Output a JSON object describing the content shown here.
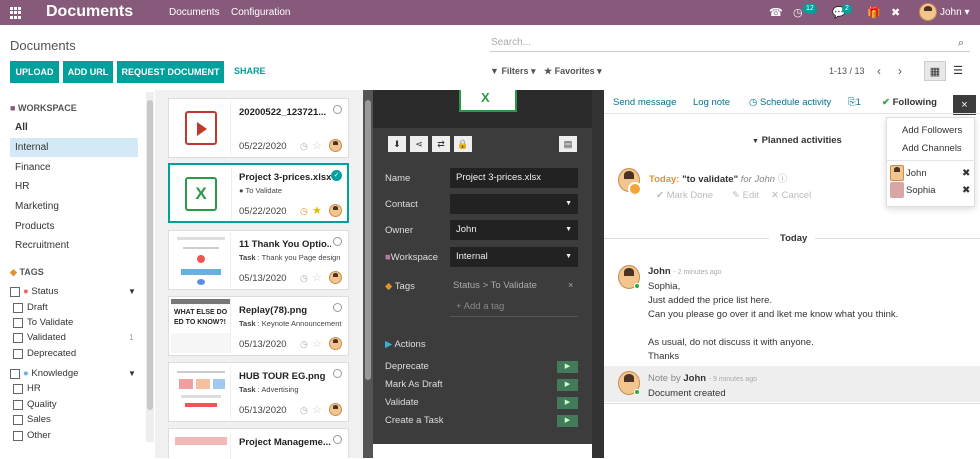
{
  "app": {
    "title": "Documents"
  },
  "topmenu": [
    "Documents",
    "Configuration"
  ],
  "systray": {
    "activity_count": "12",
    "message_count": "2",
    "user": "John"
  },
  "cp": {
    "title": "Documents",
    "search_placeholder": "Search...",
    "buttons": [
      "UPLOAD",
      "ADD URL",
      "REQUEST DOCUMENT"
    ],
    "share": "SHARE",
    "filters": "Filters",
    "favorites": "Favorites",
    "pager": "1-13 / 13"
  },
  "sidebar": {
    "workspace_title": "WORKSPACE",
    "workspaces": [
      "All",
      "Internal",
      "Finance",
      "HR",
      "Marketing",
      "Products",
      "Recruitment"
    ],
    "tags_title": "TAGS",
    "tag_groups": [
      {
        "name": "Status",
        "tags": [
          {
            "label": "Draft",
            "count": ""
          },
          {
            "label": "To Validate",
            "count": ""
          },
          {
            "label": "Validated",
            "count": "1"
          },
          {
            "label": "Deprecated",
            "count": ""
          }
        ]
      },
      {
        "name": "Knowledge",
        "tags": [
          {
            "label": "HR",
            "count": ""
          },
          {
            "label": "Quality",
            "count": ""
          },
          {
            "label": "Sales",
            "count": ""
          },
          {
            "label": "Other",
            "count": ""
          }
        ]
      }
    ]
  },
  "cards": [
    {
      "title": "20200522_123721...",
      "sub": "",
      "date": "05/22/2020"
    },
    {
      "title": "Project 3-prices.xlsx",
      "sub": "● To Validate",
      "date": "05/22/2020"
    },
    {
      "title": "11 Thank You Optio...",
      "sub_label": "Task",
      "sub": ": Thank you Page design",
      "date": "05/13/2020"
    },
    {
      "title": "Replay(78).png",
      "sub_label": "Task",
      "sub": ": Keynote Announcement",
      "date": "05/13/2020"
    },
    {
      "title": "HUB TOUR EG.png",
      "sub_label": "Task",
      "sub": ": Advertising",
      "date": "05/13/2020"
    },
    {
      "title": "Project Manageme...",
      "sub": "",
      "date": ""
    }
  ],
  "preview": {
    "fields": [
      {
        "label": "Name",
        "value": "Project 3-prices.xlsx",
        "dropdown": false
      },
      {
        "label": "Contact",
        "value": "",
        "dropdown": true
      },
      {
        "label": "Owner",
        "value": "John",
        "dropdown": true
      },
      {
        "label": "Workspace",
        "value": "Internal",
        "dropdown": true
      }
    ],
    "tags_label": "Tags",
    "tag_value": "Status > To Validate",
    "add_tag": "+ Add a tag",
    "actions_title": "Actions",
    "actions": [
      "Deprecate",
      "Mark As Draft",
      "Validate",
      "Create a Task"
    ]
  },
  "chatter": {
    "send_message": "Send message",
    "log_note": "Log note",
    "schedule": "Schedule activity",
    "attachments": "1",
    "following": "Following",
    "followers_menu": {
      "add_followers": "Add Followers",
      "add_channels": "Add Channels",
      "followers": [
        "John",
        "Sophia"
      ]
    },
    "planned_title": "Planned activities",
    "activity": {
      "when": "Today:",
      "summary": "\"to validate\"",
      "for": "for John",
      "mark_done": "Mark Done",
      "edit": "Edit",
      "cancel": "Cancel"
    },
    "today": "Today",
    "messages": [
      {
        "author": "John",
        "time": "- 2 minutes ago",
        "lines": [
          "Sophia,",
          "Just added the price list here.",
          "Can you please go over it and lket me know what you think.",
          "",
          "As usual, do not discuss it with anyone.",
          "Thanks"
        ]
      }
    ],
    "note": {
      "prefix": "Note by",
      "author": "John",
      "time": "- 9 minutes ago",
      "body": "Document created"
    }
  },
  "colors": {
    "brand": "#875a7b",
    "accent": "#00a09d"
  }
}
